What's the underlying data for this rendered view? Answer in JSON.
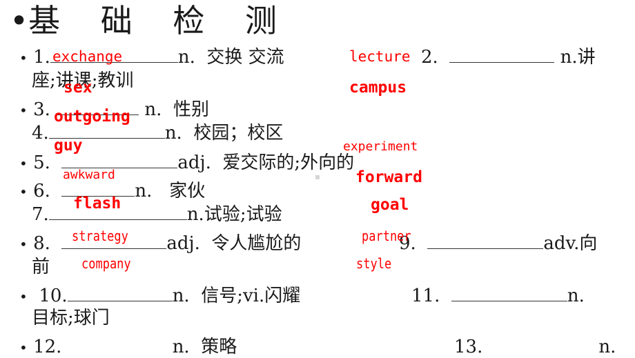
{
  "slide": {
    "title": "基 础 检 测",
    "title_bullet": "•",
    "bullet": "•"
  },
  "items": [
    {
      "num": "1.",
      "pos": "n.",
      "meaning": "交换 交流"
    },
    {
      "num": "2.",
      "pos": "n.",
      "meaning": "讲",
      "meaning_cont": "座;讲课;教训"
    },
    {
      "num": "3.",
      "pos": "n.",
      "meaning": "性别"
    },
    {
      "num": "4.",
      "pos": "n.",
      "meaning": "校园；校区"
    },
    {
      "num": "5.",
      "pos": "adj.",
      "meaning": "爱交际的;外向的"
    },
    {
      "num": "6.",
      "pos": "n.",
      "meaning": "家伙"
    },
    {
      "num": "7.",
      "pos": "n.",
      "meaning": "试验;试验"
    },
    {
      "num": "8.",
      "pos": "adj.",
      "meaning": "令人尴尬的"
    },
    {
      "num": "9.",
      "pos": "adv.",
      "meaning": "向",
      "meaning_cont": "前"
    },
    {
      "num": "10.",
      "pos": "n.",
      "meaning": "信号;vi.闪耀"
    },
    {
      "num": "11.",
      "pos": "n.",
      "meaning_cont": "目标;球门"
    },
    {
      "num": "12.",
      "pos": "n.",
      "meaning": "策略"
    },
    {
      "num": "13.",
      "pos": "n."
    }
  ],
  "answers": {
    "exchange": "exchange",
    "lecture": "lecture",
    "sex": "sex",
    "campus": "campus",
    "outgoing": "outgoing",
    "guy": "guy",
    "experiment": "experiment",
    "awkward": "awkward",
    "forward": "forward",
    "flash": "flash",
    "goal": "goal",
    "strategy": "strategy",
    "partner": "partner",
    "company": "company",
    "style": "style"
  },
  "colors": {
    "answer": "#ff0000",
    "text": "#1a1a1a"
  }
}
